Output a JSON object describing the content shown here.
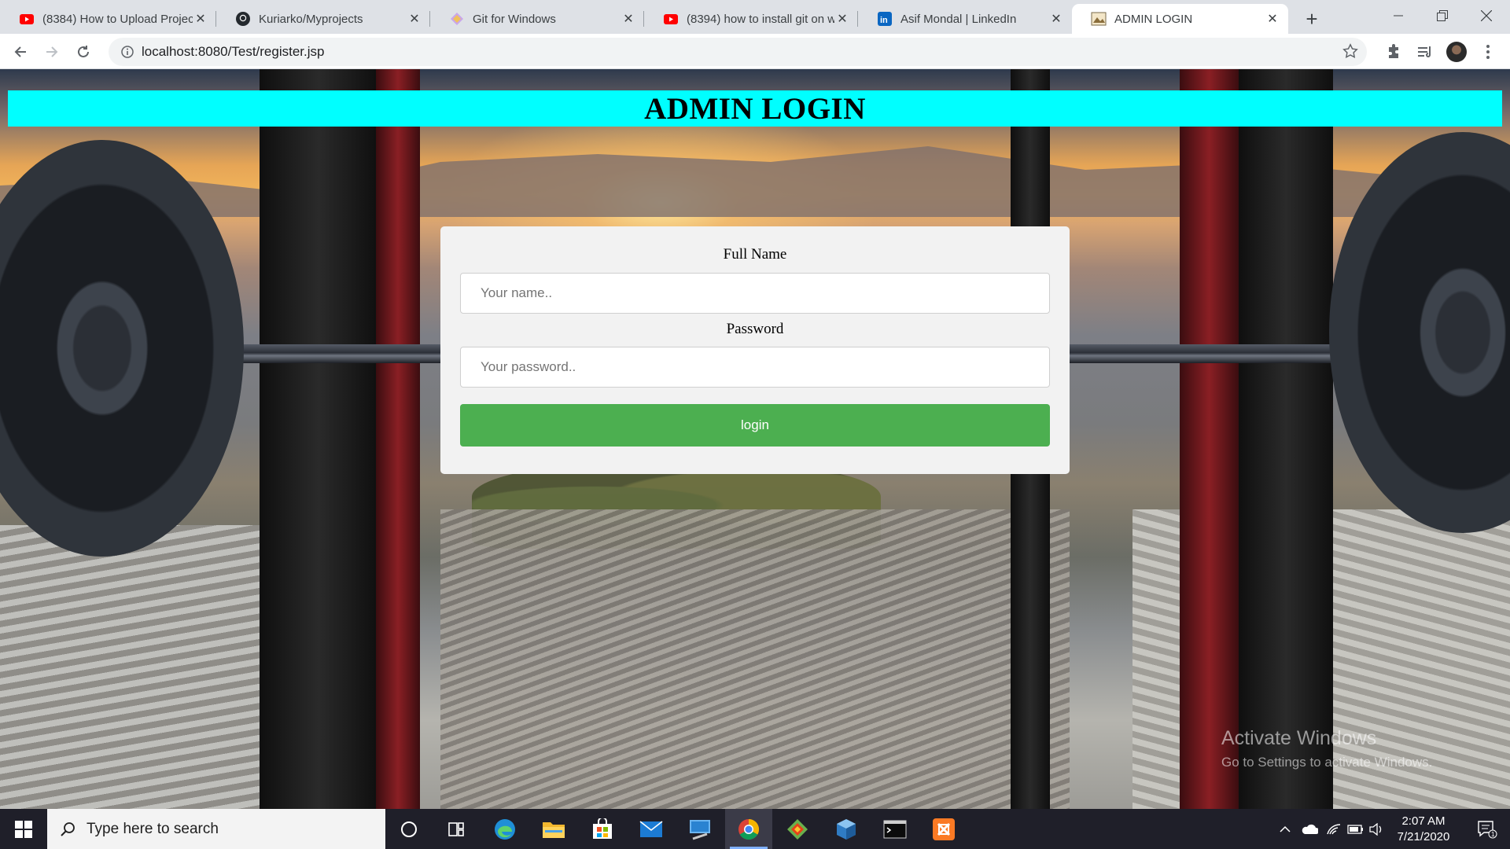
{
  "browser": {
    "tabs": [
      {
        "title": "(8384) How to Upload Projec",
        "icon": "youtube-icon",
        "active": false
      },
      {
        "title": "Kuriarko/Myprojects",
        "icon": "github-icon",
        "active": false
      },
      {
        "title": "Git for Windows",
        "icon": "git-icon",
        "active": false
      },
      {
        "title": "(8394) how to install git on w",
        "icon": "youtube-icon",
        "active": false
      },
      {
        "title": "Asif Mondal | LinkedIn",
        "icon": "linkedin-icon",
        "active": false
      },
      {
        "title": "ADMIN LOGIN",
        "icon": "page-icon",
        "active": true
      }
    ],
    "url": "localhost:8080/Test/register.jsp"
  },
  "page": {
    "heading": "ADMIN LOGIN",
    "form": {
      "name_label": "Full Name",
      "name_placeholder": "Your name..",
      "name_value": "",
      "password_label": "Password",
      "password_placeholder": "Your password..",
      "password_value": "",
      "submit_label": "login"
    },
    "colors": {
      "header_band": "#00ffff",
      "login_button": "#4caf50",
      "card": "#f2f2f2"
    }
  },
  "watermark": {
    "line1": "Activate Windows",
    "line2": "Go to Settings to activate Windows."
  },
  "taskbar": {
    "search_placeholder": "Type here to search",
    "apps": [
      "cortana-icon",
      "task-view-icon",
      "edge-icon",
      "file-explorer-icon",
      "store-icon",
      "mail-icon",
      "desktop-app-icon",
      "chrome-icon",
      "git-gui-icon",
      "virtualbox-icon",
      "terminal-icon",
      "xampp-icon"
    ],
    "time": "2:07 AM",
    "date": "7/21/2020",
    "notification_count": "1"
  }
}
